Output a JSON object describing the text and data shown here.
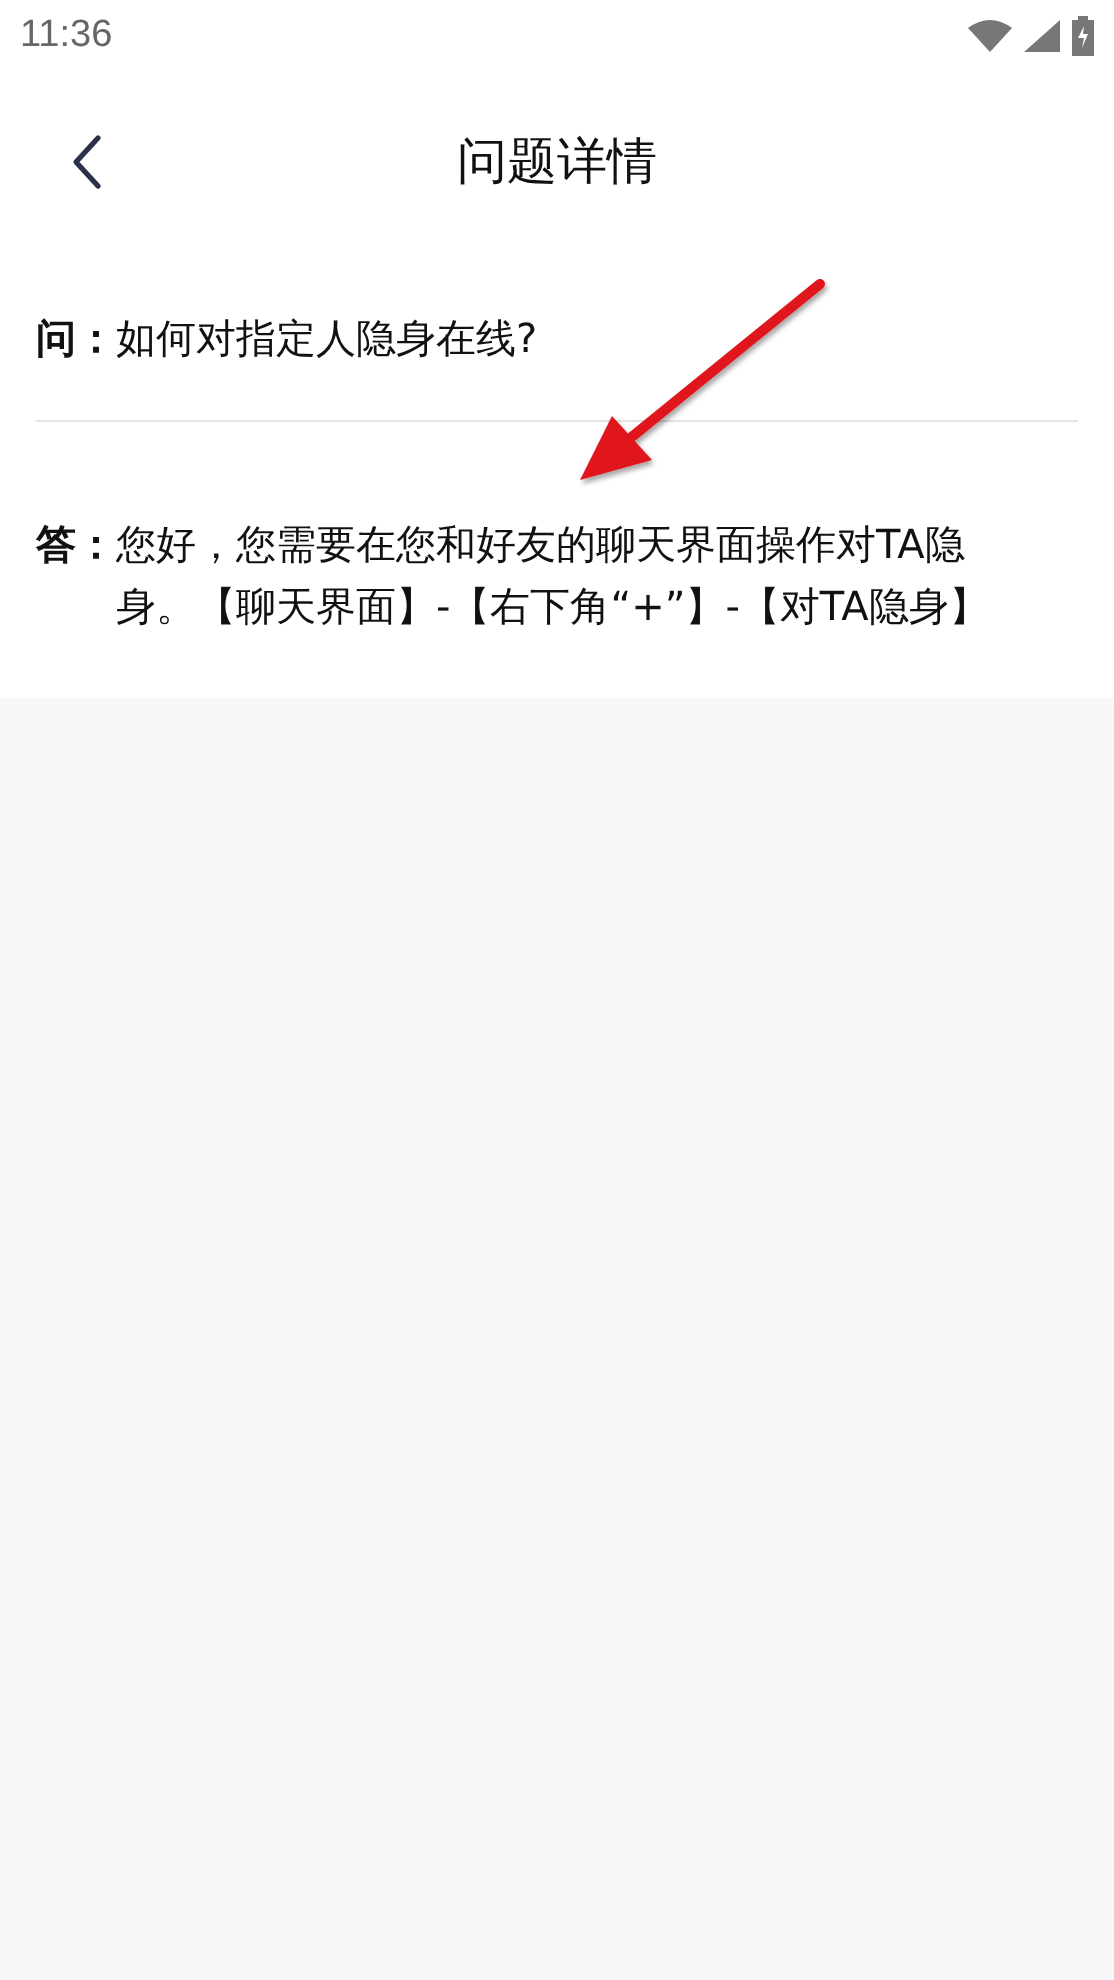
{
  "status_bar": {
    "time": "11:36"
  },
  "header": {
    "title": "问题详情"
  },
  "question": {
    "label": "问：",
    "text": "如何对指定人隐身在线?"
  },
  "answer": {
    "label": "答：",
    "text": "您好，您需要在您和好友的聊天界面操作对TA隐身。【聊天界面】-【右下角“+”】-【对TA隐身】"
  }
}
